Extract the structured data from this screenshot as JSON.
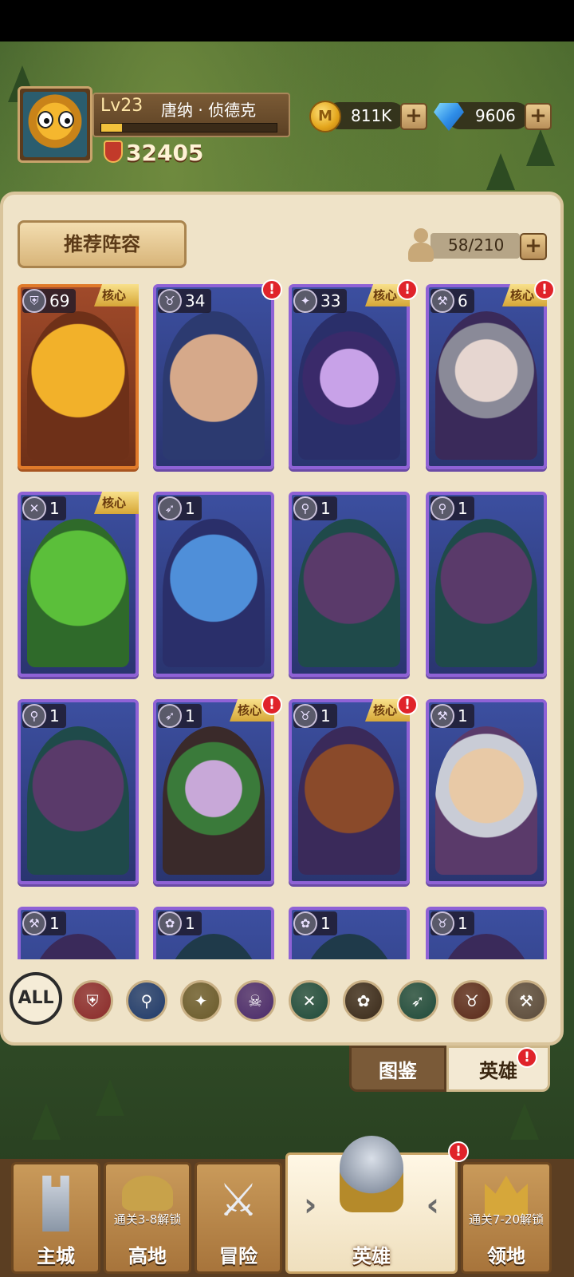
{
  "player": {
    "level": "Lv23",
    "name": "唐纳 · 侦德克",
    "xp_fraction": 0.12,
    "power": "32405"
  },
  "resources": {
    "gold": "811K",
    "gold_icon_letter": "M",
    "gems": "9606",
    "plus": "+"
  },
  "recommend_button": "推荐阵容",
  "hero_slots": "58/210",
  "core_label": "核心",
  "alert_mark": "!",
  "heroes": [
    {
      "level": "69",
      "class": "shield",
      "core": true,
      "alert": false
    },
    {
      "level": "34",
      "class": "beast",
      "core": false,
      "alert": true
    },
    {
      "level": "33",
      "class": "holy",
      "core": true,
      "alert": true
    },
    {
      "level": "6",
      "class": "axe",
      "core": true,
      "alert": true
    },
    {
      "level": "1",
      "class": "blade",
      "core": true,
      "alert": false
    },
    {
      "level": "1",
      "class": "bow",
      "core": false,
      "alert": false
    },
    {
      "level": "1",
      "class": "mage",
      "core": false,
      "alert": false
    },
    {
      "level": "1",
      "class": "mage",
      "core": false,
      "alert": false
    },
    {
      "level": "1",
      "class": "mage",
      "core": false,
      "alert": false
    },
    {
      "level": "1",
      "class": "bow",
      "core": true,
      "alert": true
    },
    {
      "level": "1",
      "class": "beast",
      "core": true,
      "alert": true
    },
    {
      "level": "1",
      "class": "axe",
      "core": false,
      "alert": false
    },
    {
      "level": "1",
      "class": "axe",
      "core": false,
      "alert": false
    },
    {
      "level": "1",
      "class": "paw",
      "core": false,
      "alert": false
    },
    {
      "level": "1",
      "class": "paw",
      "core": false,
      "alert": false
    },
    {
      "level": "1",
      "class": "beast",
      "core": false,
      "alert": false
    }
  ],
  "filters": {
    "all": "ALL",
    "items": [
      "shield-icon",
      "mage-staff-icon",
      "holy-wings-icon",
      "skull-icon",
      "crossed-blades-icon",
      "paw-icon",
      "bow-icon",
      "bull-icon",
      "axe-icon"
    ]
  },
  "subtabs": {
    "atlas": "图鉴",
    "heroes": "英雄"
  },
  "nav": {
    "main_city": "主城",
    "highland": "高地",
    "highland_lock": "通关3-8解锁",
    "adventure": "冒险",
    "heroes": "英雄",
    "territory": "领地",
    "territory_lock": "通关7-20解锁"
  }
}
